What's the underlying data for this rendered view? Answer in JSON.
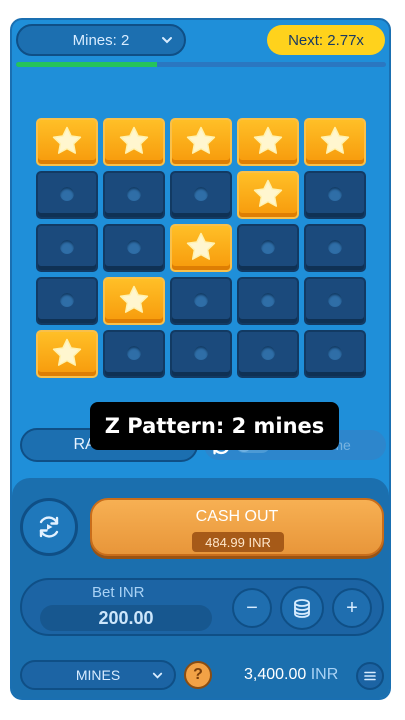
{
  "header": {
    "mines_select": "Mines: 2",
    "next_multiplier": "Next: 2.77x",
    "progress_fraction": 0.38
  },
  "grid": {
    "rows": [
      [
        "star",
        "star",
        "star",
        "star",
        "star"
      ],
      [
        "hidden",
        "hidden",
        "hidden",
        "star",
        "hidden"
      ],
      [
        "hidden",
        "hidden",
        "star",
        "hidden",
        "hidden"
      ],
      [
        "hidden",
        "star",
        "hidden",
        "hidden",
        "hidden"
      ],
      [
        "star",
        "hidden",
        "hidden",
        "hidden",
        "hidden"
      ]
    ]
  },
  "caption": "Z Pattern: 2 mines",
  "controls": {
    "random_label": "RANDOM",
    "auto_game_label": "Auto Game",
    "auto_game_on": false
  },
  "cashout": {
    "label": "CASH OUT",
    "amount": "484.99 INR"
  },
  "bet": {
    "label": "Bet INR",
    "value": "200.00",
    "minus": "−",
    "plus": "+"
  },
  "footer": {
    "game_select": "MINES",
    "help": "?",
    "balance_amount": "3,400.00",
    "balance_currency": "INR"
  },
  "colors": {
    "background": "#1f8fd9",
    "accent_yellow": "#ffd21c",
    "star_tile": "#ffb020",
    "hidden_tile": "#1b4a7c",
    "cashout": "#f0a448",
    "progress": "#25c35b"
  }
}
